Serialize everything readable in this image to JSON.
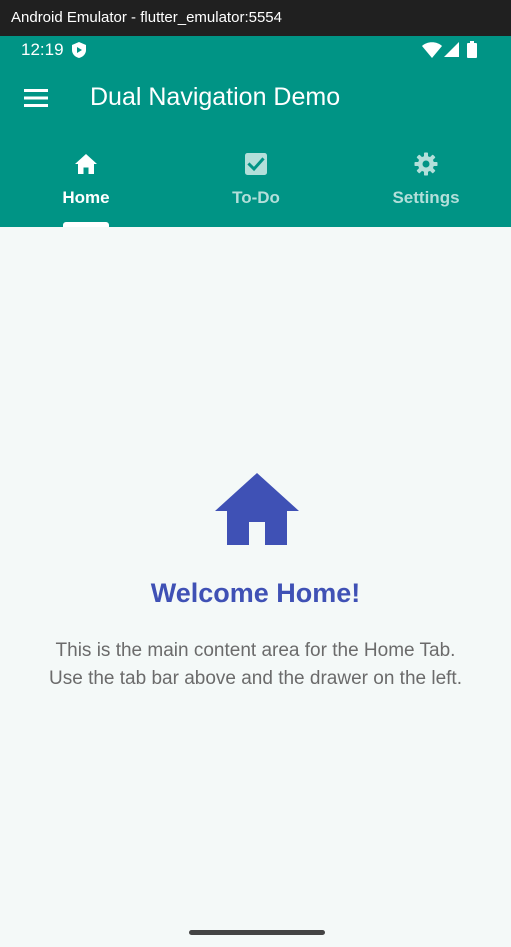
{
  "window": {
    "title": "Android Emulator - flutter_emulator:5554"
  },
  "status_bar": {
    "time": "12:19",
    "icons": [
      "shield-icon",
      "wifi-icon",
      "signal-icon",
      "battery-icon"
    ]
  },
  "app_bar": {
    "title": "Dual Navigation Demo",
    "menu_icon": "menu-icon",
    "color": "#009485"
  },
  "tabs": [
    {
      "label": "Home",
      "icon": "home-icon",
      "selected": true
    },
    {
      "label": "To-Do",
      "icon": "checkbox-icon",
      "selected": false
    },
    {
      "label": "Settings",
      "icon": "gear-icon",
      "selected": false
    }
  ],
  "content": {
    "icon": "home-icon",
    "heading": "Welcome Home!",
    "body_lines": [
      "This is the main content area for the Home Tab.",
      "Use the tab bar above and the drawer on the left."
    ],
    "accent_color": "#3f51b5"
  },
  "colors": {
    "primary": "#009485",
    "background": "#f4f9f8",
    "inactive_tab": "#b3dfda"
  }
}
